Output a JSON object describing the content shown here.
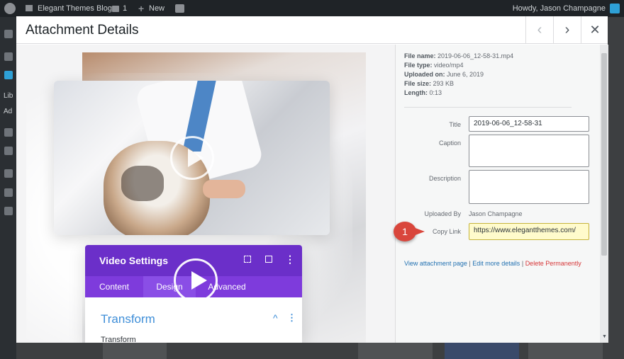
{
  "admin_bar": {
    "site_name": "Elegant Themes Blog",
    "comments_count": "1",
    "new_label": "New",
    "howdy": "Howdy, Jason Champagne"
  },
  "side_menu": {
    "lib_text": "Lib",
    "add_text": "Ad"
  },
  "modal": {
    "title": "Attachment Details",
    "prev_label": "‹",
    "next_label": "›",
    "close_label": "✕"
  },
  "divi": {
    "panel_title": "Video Settings",
    "more_icon": "⋮",
    "tabs": [
      {
        "label": "Content"
      },
      {
        "label": "Design"
      },
      {
        "label": "Advanced"
      }
    ],
    "active_tab": "Design",
    "section_title": "Transform",
    "chevron": "^",
    "section_more": "⋮",
    "sub_label": "Transform"
  },
  "details": {
    "file_name_label": "File name:",
    "file_name": "2019-06-06_12-58-31.mp4",
    "file_type_label": "File type:",
    "file_type": "video/mp4",
    "uploaded_on_label": "Uploaded on:",
    "uploaded_on": "June 6, 2019",
    "file_size_label": "File size:",
    "file_size": "293 KB",
    "length_label": "Length:",
    "length": "0:13",
    "title_label": "Title",
    "title_value": "2019-06-06_12-58-31",
    "caption_label": "Caption",
    "caption_value": "",
    "description_label": "Description",
    "description_value": "",
    "uploaded_by_label": "Uploaded By",
    "uploaded_by": "Jason Champagne",
    "copy_link_label": "Copy Link",
    "copy_link_value": "https://www.elegantthemes.com/",
    "view_attachment": "View attachment page",
    "edit_details": "Edit more details",
    "delete_permanently": "Delete Permanently",
    "pipe": "|"
  },
  "callout": {
    "number": "1"
  },
  "colors": {
    "divi_purple": "#6b2fc9",
    "divi_tab_purple": "#7e3bdc",
    "link_blue": "#2271b1",
    "danger_red": "#d63638",
    "callout_red": "#d9463c"
  },
  "icons": {
    "wordpress": "wordpress-logo-icon",
    "home": "home-icon",
    "comments": "comment-bubble-icon",
    "new": "plus-icon",
    "yoast": "yoast-icon",
    "avatar": "user-avatar-icon",
    "play": "play-circle-icon"
  }
}
